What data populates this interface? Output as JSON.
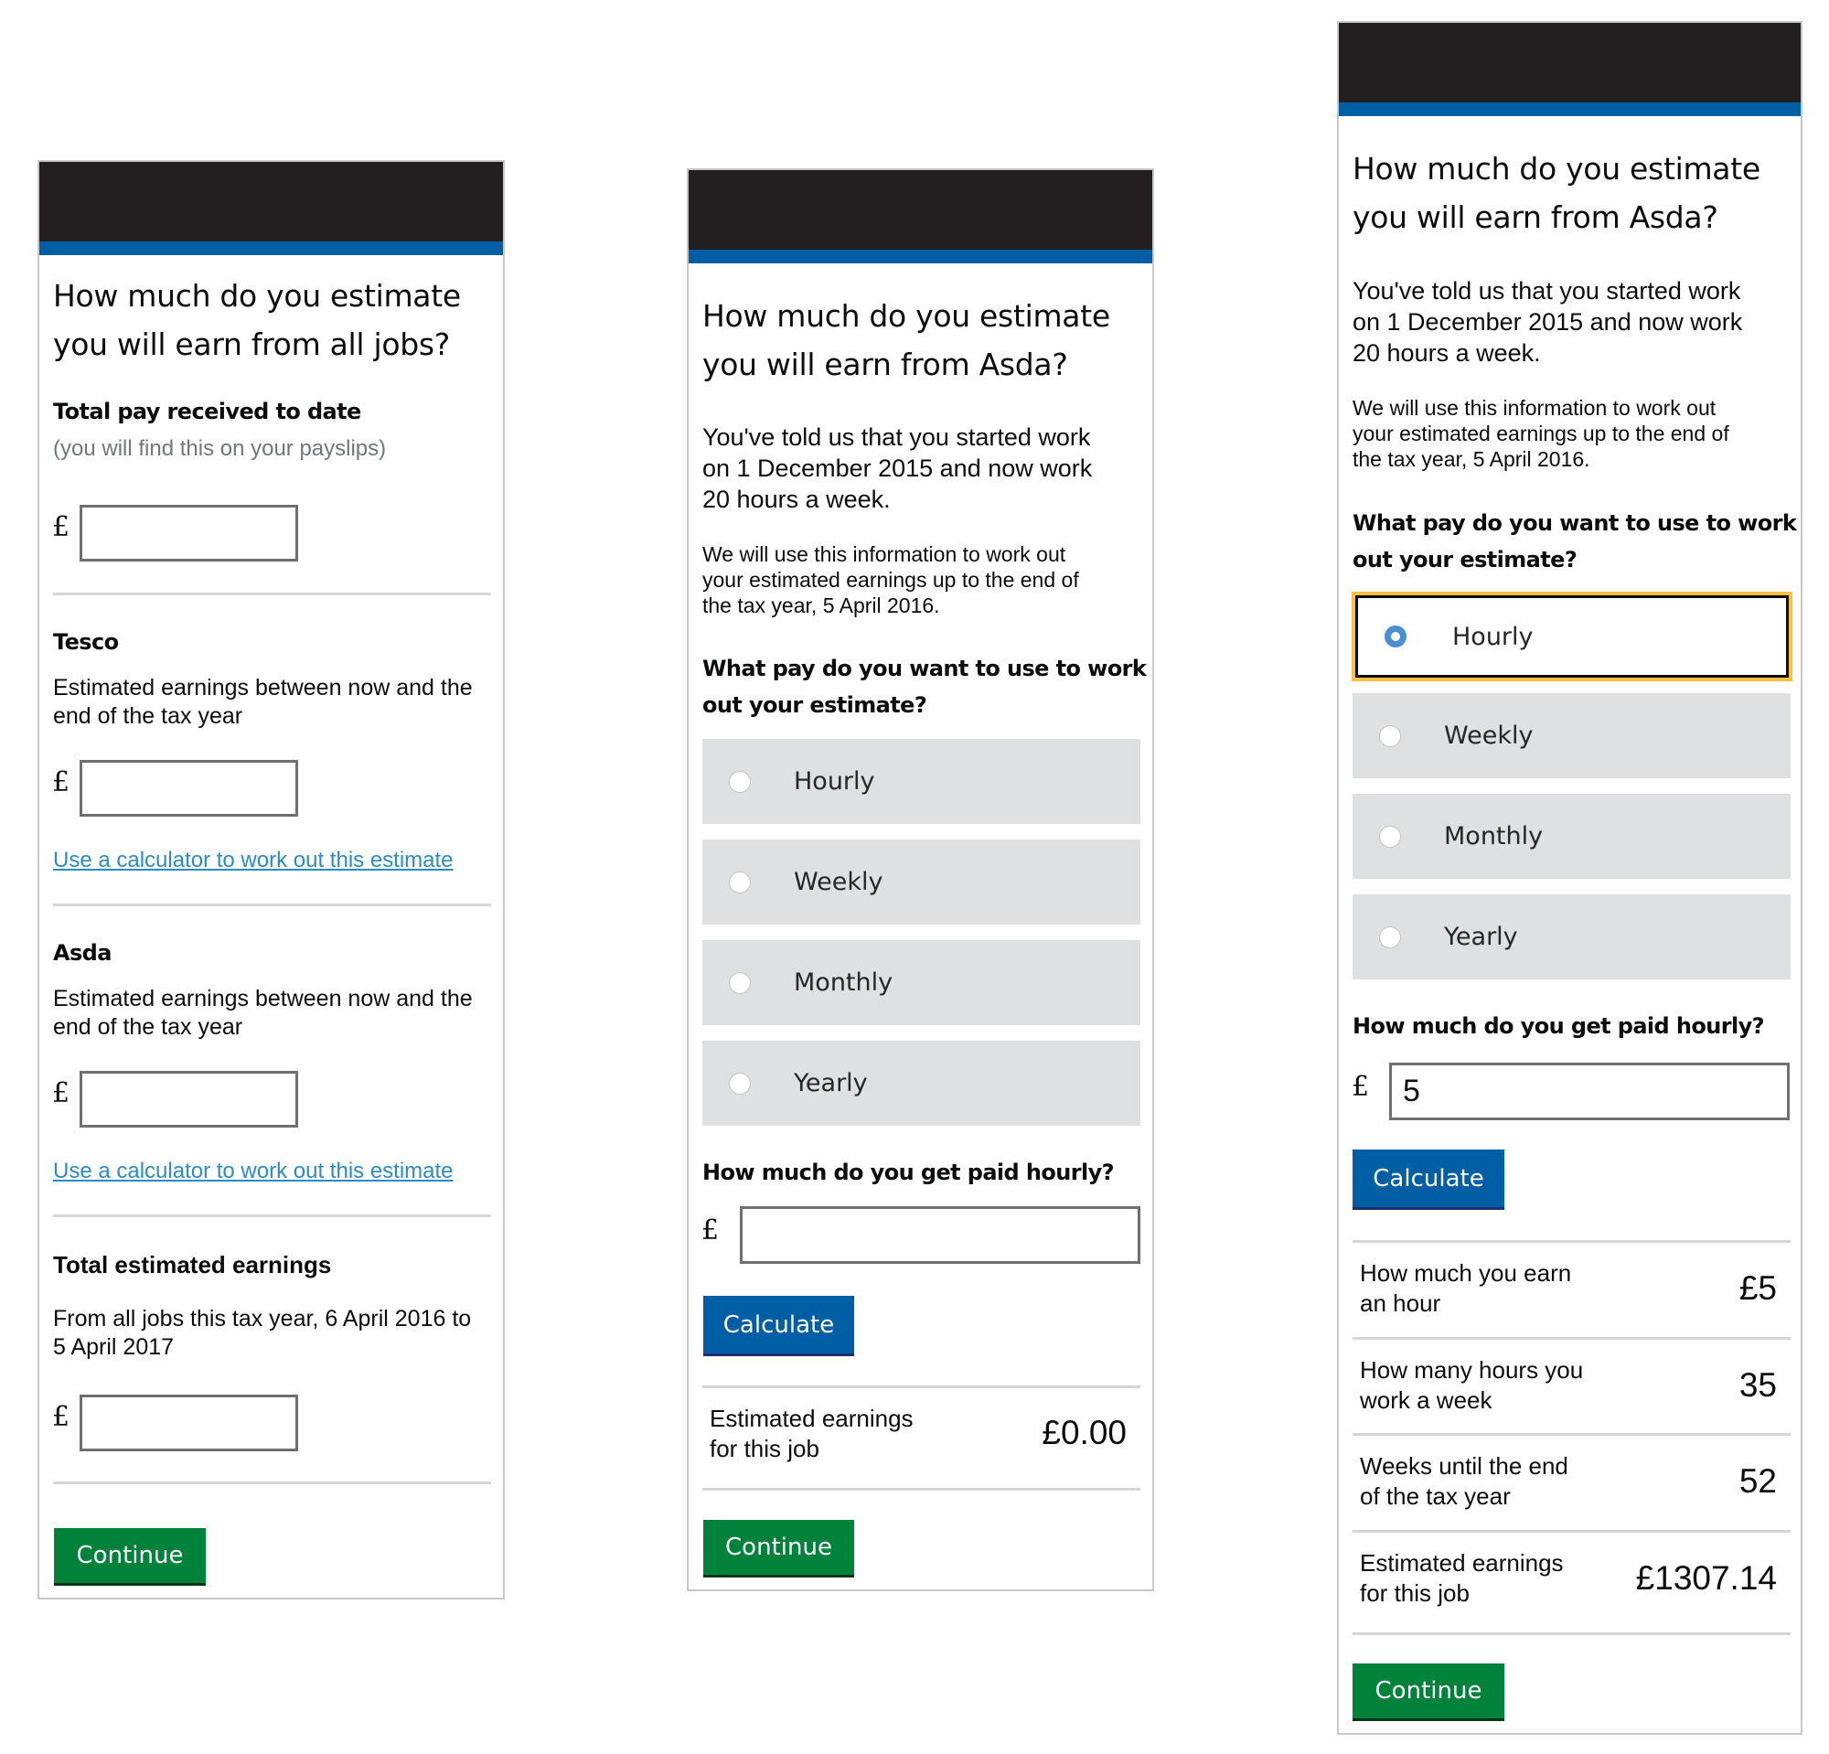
{
  "screens": [
    {
      "heading_line1": "How much do you estimate",
      "heading_line2": "you will earn from all jobs?",
      "currency_symbol": "£",
      "sections": [
        {
          "title": "Total pay received to date",
          "hint": "(you will find this on your payslips)",
          "input_value": ""
        },
        {
          "title": "Tesco",
          "description_line1": "Estimated earnings between now and the",
          "description_line2": "end of the tax year",
          "input_value": "",
          "link": "Use a calculator to work out this estimate"
        },
        {
          "title": "Asda",
          "description_line1": "Estimated earnings between now and the",
          "description_line2": "end of the tax year",
          "input_value": "",
          "link": "Use a calculator to work out this estimate"
        },
        {
          "title": "Total estimated earnings",
          "description_line1": "From all jobs this tax year, 6 April 2016 to",
          "description_line2": "5 April 2017",
          "input_value": ""
        }
      ],
      "continue_label": "Continue"
    },
    {
      "heading_line1": "How much do you estimate",
      "heading_line2": "you will earn from Asda?",
      "intro_line1": "You've told us that you started work",
      "intro_line2": "on 1 December 2015 and now work",
      "intro_line3": "20 hours a week.",
      "info_line1": "We will use this information to work out",
      "info_line2": "your estimated earnings up to the end of",
      "info_line3": "the tax year, 5 April 2016.",
      "question_line1": "What pay do you want to use to work",
      "question_line2": "out your estimate?",
      "options": [
        "Hourly",
        "Weekly",
        "Monthly",
        "Yearly"
      ],
      "selected_option": null,
      "amount_label": "How much do you get paid hourly?",
      "currency_symbol": "£",
      "amount_value": "",
      "calculate_label": "Calculate",
      "results": [
        {
          "label_line1": "Estimated earnings",
          "label_line2": "for this job",
          "value": "£0.00"
        }
      ],
      "continue_label": "Continue"
    },
    {
      "heading_line1": "How much do you estimate",
      "heading_line2": "you will earn from Asda?",
      "intro_line1": "You've told us that you started work",
      "intro_line2": "on 1 December 2015 and now work",
      "intro_line3": "20 hours a week.",
      "info_line1": "We will use this information to work out",
      "info_line2": "your estimated earnings up to the end of",
      "info_line3": "the tax year, 5 April 2016.",
      "question_line1": "What pay do you want to use to work",
      "question_line2": "out your estimate?",
      "options": [
        "Hourly",
        "Weekly",
        "Monthly",
        "Yearly"
      ],
      "selected_option": "Hourly",
      "amount_label": "How much do you get paid hourly?",
      "currency_symbol": "£",
      "amount_value": "5",
      "calculate_label": "Calculate",
      "results": [
        {
          "label_line1": "How much you earn",
          "label_line2": "an hour",
          "value": "£5"
        },
        {
          "label_line1": "How many hours you",
          "label_line2": "work a week",
          "value": "35"
        },
        {
          "label_line1": "Weeks until the end",
          "label_line2": "of the tax year",
          "value": "52"
        },
        {
          "label_line1": "Estimated earnings",
          "label_line2": "for this job",
          "value": "£1307.14"
        }
      ],
      "continue_label": "Continue"
    }
  ],
  "colors": {
    "header": "#231f20",
    "header_bar": "#005ea5",
    "continue_button": "#00823b",
    "calculate_button": "#005ea5",
    "link": "#2b8cc4",
    "focus": "#ffbf47",
    "option_bg": "#dee0e2",
    "selected_radio": "#4a8fd4"
  }
}
